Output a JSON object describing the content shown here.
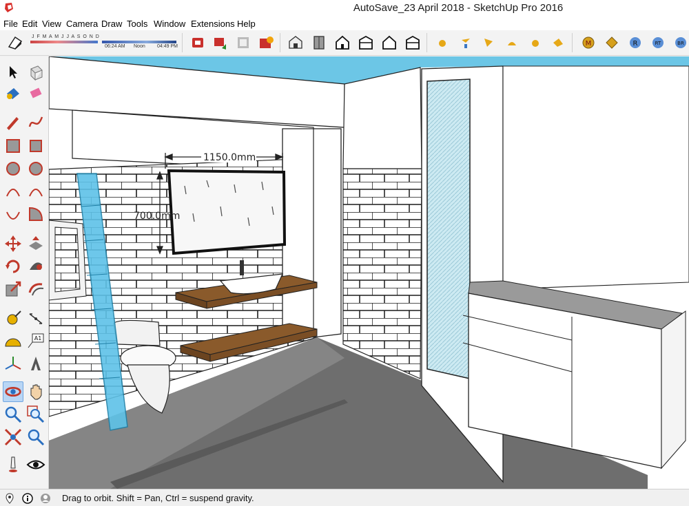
{
  "window": {
    "title": "AutoSave_23 April 2018 - SketchUp Pro 2016"
  },
  "menu": {
    "items": [
      "File",
      "Edit",
      "View",
      "Camera",
      "Draw",
      "Tools",
      "Window",
      "Extensions",
      "Help"
    ]
  },
  "shadows": {
    "months": "J F M A M J J A S O N D",
    "time_start": "06:24 AM",
    "time_noon": "Noon",
    "time_end": "04:49 PM"
  },
  "toolbar_icons": [
    "styles-icon",
    "shadow-settings-icon",
    "3d-warehouse-icon",
    "share-model-icon",
    "extension-warehouse-icon",
    "extension-manager-icon",
    "iso-view-icon",
    "top-view-icon",
    "front-view-icon",
    "right-view-icon",
    "back-view-icon",
    "left-view-icon",
    "sandbox-icon",
    "sandbox-from-contours-icon",
    "sandbox-smoove-icon",
    "sandbox-stamp-icon",
    "sandbox-drape-icon",
    "sandbox-add-detail-icon",
    "m-plugin-icon",
    "tag-plugin-icon",
    "r-plugin-icon",
    "rt-plugin-icon",
    "br-plugin-icon"
  ],
  "dimensions": {
    "width_label": "1150.0mm",
    "height_label": "700.0mm"
  },
  "status": {
    "message": "Drag to orbit. Shift = Pan, Ctrl = suspend gravity."
  },
  "colors": {
    "sky": "#6cc6e6",
    "glass": "#5ec2e8",
    "wood": "#8a5a2b",
    "floor": "#6e6e6e",
    "active_tool": "#b9d6f5"
  }
}
